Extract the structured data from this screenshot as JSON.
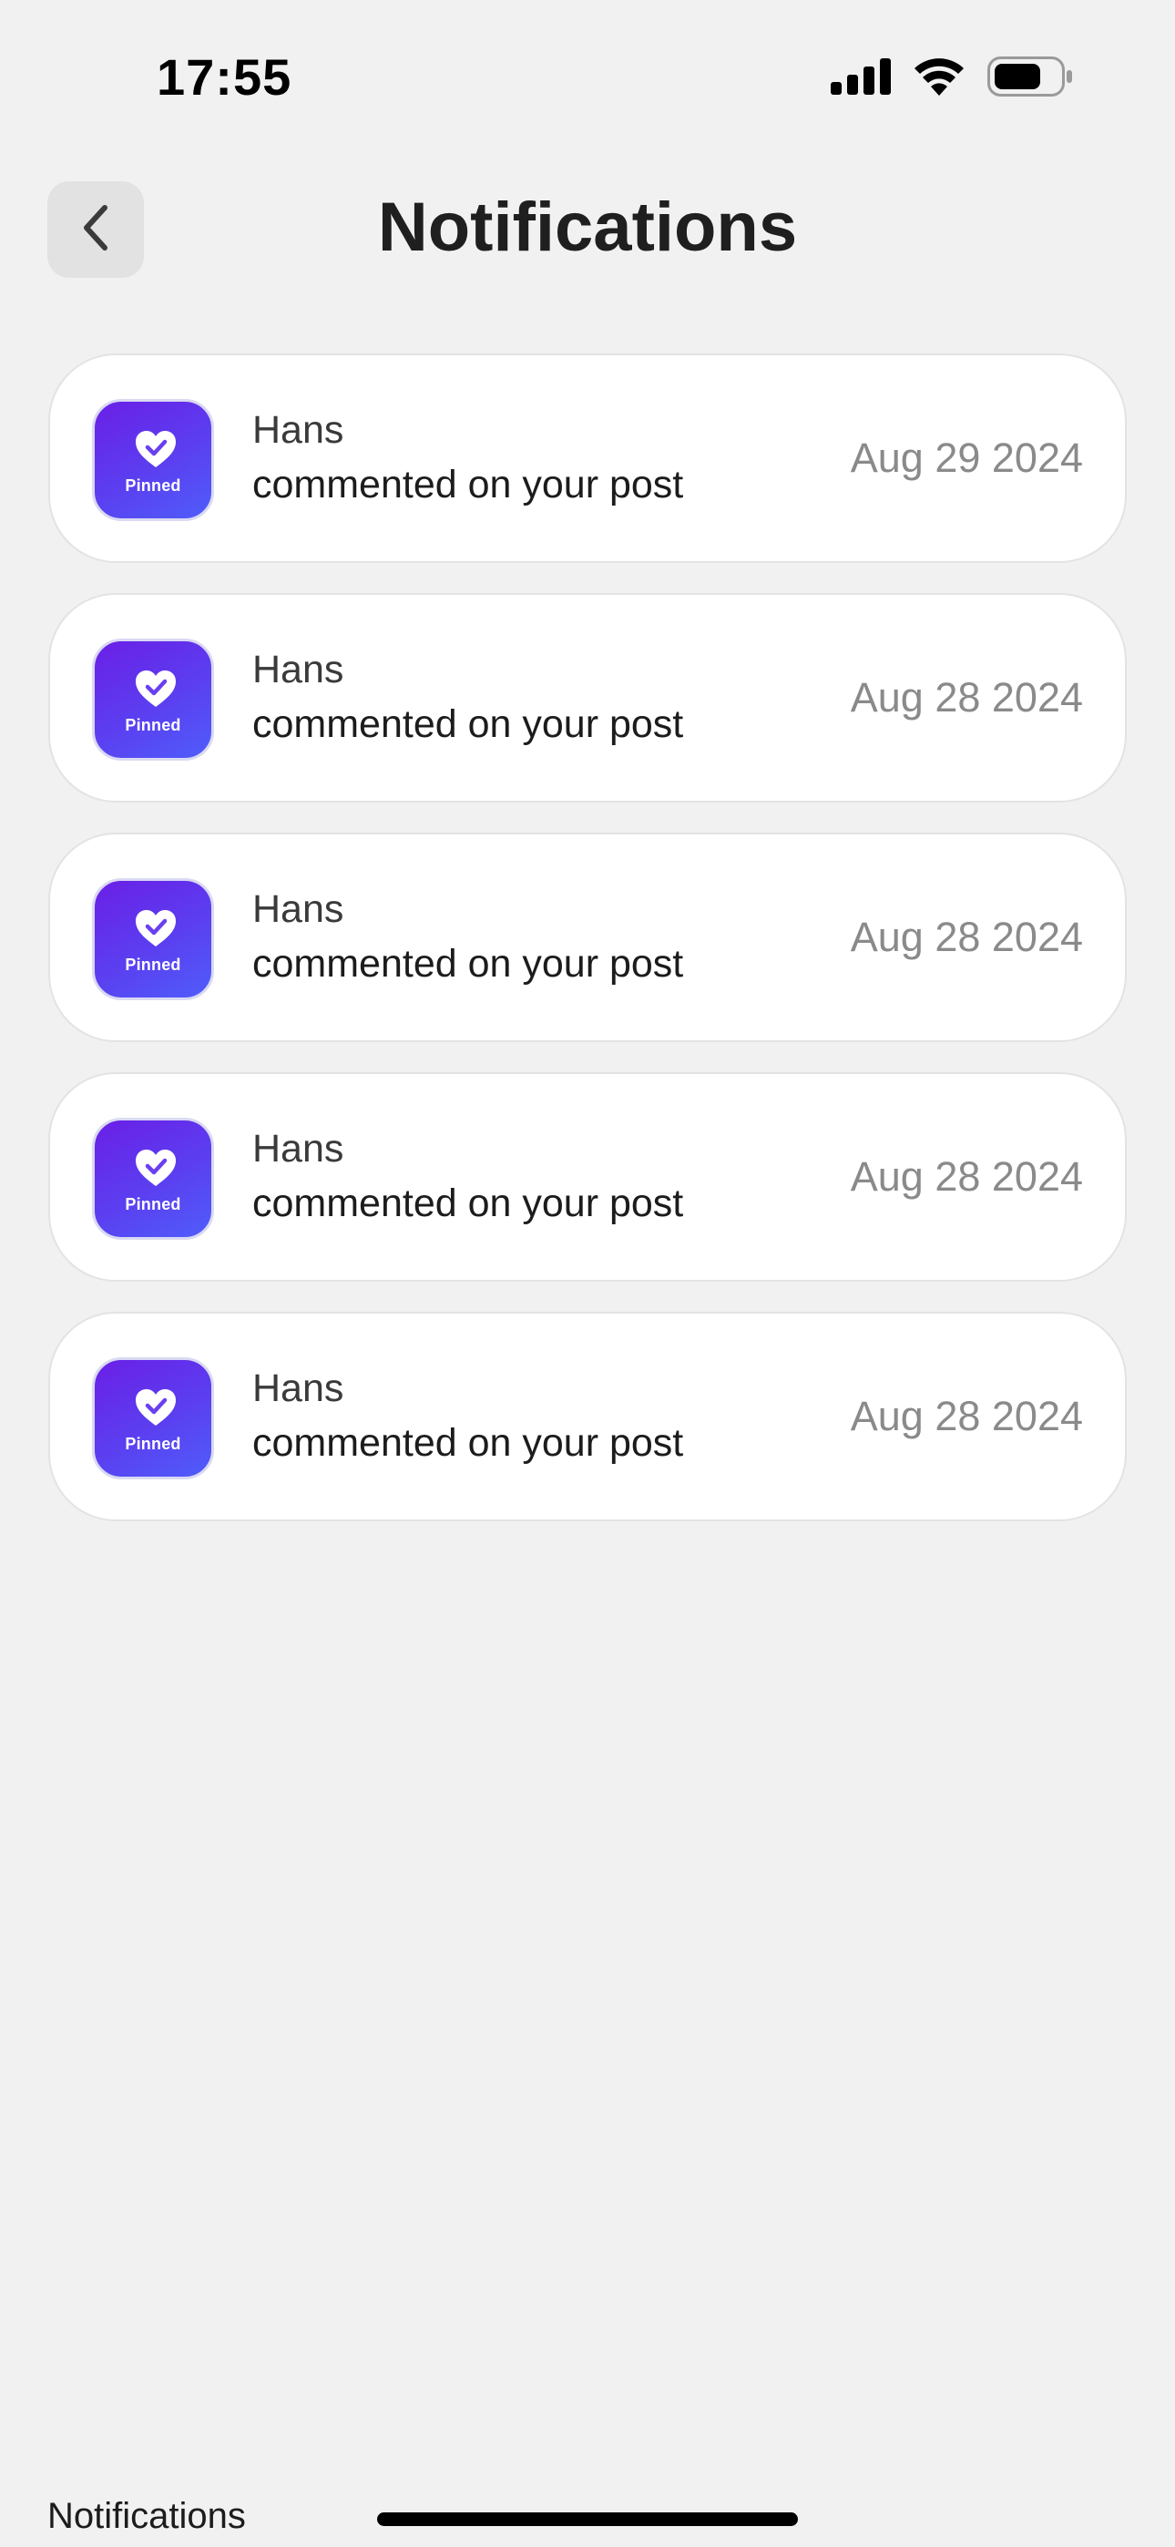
{
  "status_bar": {
    "time": "17:55",
    "icons": [
      "cellular-signal-icon",
      "wifi-icon",
      "battery-icon"
    ]
  },
  "header": {
    "back_icon": "chevron-left-icon",
    "title": "Notifications"
  },
  "notifications": [
    {
      "user": "Hans",
      "message": "commented on your post",
      "date": "Aug 29 2024",
      "icon_label": "Pinned"
    },
    {
      "user": "Hans",
      "message": "commented on your post",
      "date": "Aug 28 2024",
      "icon_label": "Pinned"
    },
    {
      "user": "Hans",
      "message": "commented on your post",
      "date": "Aug 28 2024",
      "icon_label": "Pinned"
    },
    {
      "user": "Hans",
      "message": "commented on your post",
      "date": "Aug 28 2024",
      "icon_label": "Pinned"
    },
    {
      "user": "Hans",
      "message": "commented on your post",
      "date": "Aug 28 2024",
      "icon_label": "Pinned"
    }
  ],
  "bottom": {
    "label": "Notifications"
  },
  "colors": {
    "background": "#f1f1f1",
    "card": "#ffffff",
    "icon_gradient_start": "#6a1fe6",
    "icon_gradient_end": "#4f5dfb",
    "date_text": "#8a8a8a"
  }
}
